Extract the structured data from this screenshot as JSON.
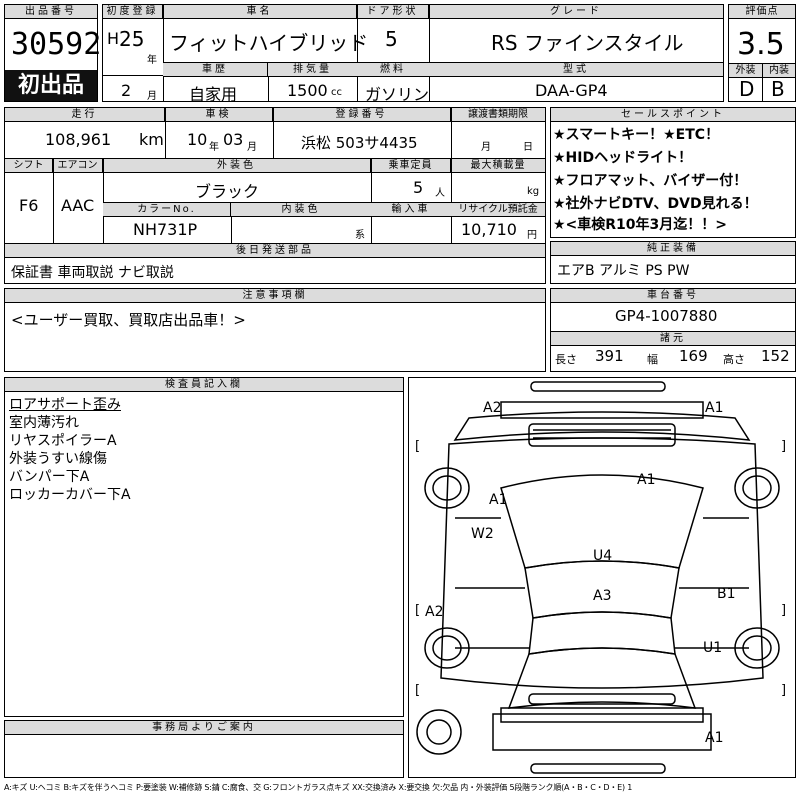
{
  "header_labels": {
    "lot": "出品番号",
    "first_reg": "初度登録",
    "car_name": "車名",
    "door": "ドア形状",
    "grade": "グレード",
    "score": "評価点",
    "history": "車歴",
    "displacement": "排気量",
    "fuel": "燃料",
    "model_code": "型式",
    "ext": "外装",
    "int": "内装",
    "mileage": "走行",
    "inspection": "車検",
    "plate": "登録番号",
    "transfer": "譲渡書類期限",
    "shift": "シフト",
    "ac": "エアコン",
    "color": "外装色",
    "capacity": "乗車定員",
    "max_load": "最大積載量",
    "color_no": "カラーNo.",
    "int_color": "内装色",
    "import": "輸入車",
    "recycle": "リサイクル預託金",
    "later_parts": "後日発送部品",
    "sales_points": "セールスポイント",
    "std_equip": "純正装備",
    "notes": "注意事項欄",
    "chassis": "車台番号",
    "dims": "諸元",
    "inspector": "検査員記入欄",
    "office": "事務局よりご案内"
  },
  "lot_number": "30592",
  "first_listing": "初出品",
  "year_era": "H",
  "year": "25",
  "year_unit": "年",
  "month": "2",
  "month_unit": "月",
  "car_name": "フィットハイブリッド",
  "doors": "5",
  "grade": "RS ファインスタイル",
  "score": "3.5",
  "history": "自家用",
  "displacement": "1500",
  "displacement_unit": "cc",
  "fuel": "ガソリン",
  "model_code": "DAA-GP4",
  "exterior_grade": "D",
  "interior_grade": "B",
  "mileage": "108,961",
  "mileage_unit": "km",
  "inspection_year": "10",
  "inspection_year_unit": "年",
  "inspection_month": "03",
  "inspection_month_unit": "月",
  "plate": "浜松 503サ4435",
  "transfer_month_unit": "月",
  "transfer_day_unit": "日",
  "shift": "F6",
  "ac": "AAC",
  "color": "ブラック",
  "capacity": "5",
  "capacity_unit": "人",
  "max_load_unit": "kg",
  "color_no": "NH731P",
  "int_color_unit": "系",
  "recycle": "10,710",
  "recycle_unit": "円",
  "later_parts": "保証書 車両取説 ナビ取説",
  "sales_points": [
    "★スマートキー！★ETC！",
    "★HIDヘッドライト！",
    "★フロアマット、バイザー付！",
    "★社外ナビDTV、DVD見れる！",
    "★<車検R10年3月迄！！>"
  ],
  "std_equip": "エアB アルミ PS PW",
  "notes": "<ユーザー買取、買取店出品車！>",
  "chassis": "GP4-1007880",
  "length_label": "長さ",
  "length": "391",
  "width_label": "幅",
  "width": "169",
  "height_label": "高さ",
  "height": "152",
  "inspector_notes": [
    "ロアサポート歪み",
    "室内薄汚れ",
    "リヤスポイラーA",
    "外装うすい線傷",
    "バンパー下A",
    "ロッカーカバー下A"
  ],
  "damage_marks": {
    "front_left": "A2",
    "front_right": "A1",
    "hood": "A1",
    "left_front_fender": "A1",
    "left_front_door": "W2",
    "roof": "U4",
    "rear_window_area": "A3",
    "right_door": "B1",
    "left_rear": "A2",
    "right_rear": "U1",
    "rear_bumper": "A1"
  },
  "legend": "A:キズ U:ヘコミ B:キズを伴うヘコミ P:要塗装 W:補修跡 S:錆 C:腐食、交 G:フロントガラス点キズ XX:交換済み X:要交換 欠:欠品 内・外装評価 5段階ランク順(A・B・C・D・E) 1"
}
